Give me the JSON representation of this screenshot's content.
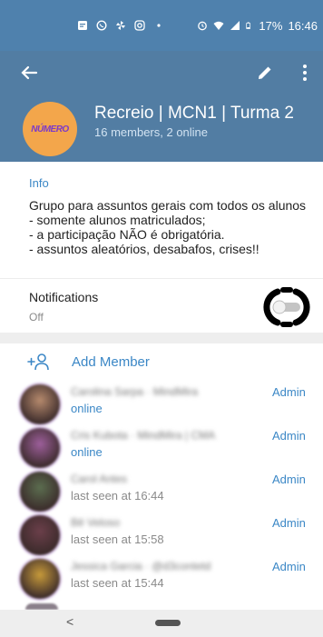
{
  "status_bar": {
    "battery": "17%",
    "time": "16:46",
    "icons": [
      "notification-icon",
      "whatsapp-icon",
      "pinwheel-icon",
      "instagram-icon",
      "dot-icon",
      "alarm-icon",
      "wifi-icon",
      "signal-icon",
      "battery-icon"
    ]
  },
  "header": {
    "back_icon": "arrow-left-icon",
    "edit_icon": "pencil-icon",
    "more_icon": "more-vertical-icon",
    "group_name": "Recreio | MCN1 | Turma 2",
    "group_meta": "16 members, 2 online",
    "avatar_text": "NÚMERO"
  },
  "info": {
    "label": "Info",
    "description": "Grupo para assuntos gerais com todos os alunos\n- somente alunos matriculados;\n- a participação NÃO é obrigatória.\n- assuntos aleatórios, desabafos, crises!!"
  },
  "notifications": {
    "label": "Notifications",
    "value": "Off",
    "enabled": false
  },
  "add_member": {
    "label": "Add Member",
    "icon": "add-person-icon"
  },
  "members": [
    {
      "name": "Carolina Sarpa · MindMira",
      "status": "online",
      "online": true,
      "role": "Admin",
      "avatar_color": "#b68a6d"
    },
    {
      "name": "Cris Kubota · MindMira | CMA",
      "status": "online",
      "online": true,
      "role": "Admin",
      "avatar_color": "#9d5f9b"
    },
    {
      "name": "Carol Antes",
      "status": "last seen at 16:44",
      "online": false,
      "role": "Admin",
      "avatar_color": "#5b6d4f"
    },
    {
      "name": "Bê Veloso",
      "status": "last seen at 15:58",
      "online": false,
      "role": "Admin",
      "avatar_color": "#6b3f4a"
    },
    {
      "name": "Jessica Garcia · @d3contetd",
      "status": "last seen at 15:44",
      "online": false,
      "role": "Admin",
      "avatar_color": "#c79a3a"
    }
  ],
  "nav": {
    "back_glyph": "<"
  }
}
